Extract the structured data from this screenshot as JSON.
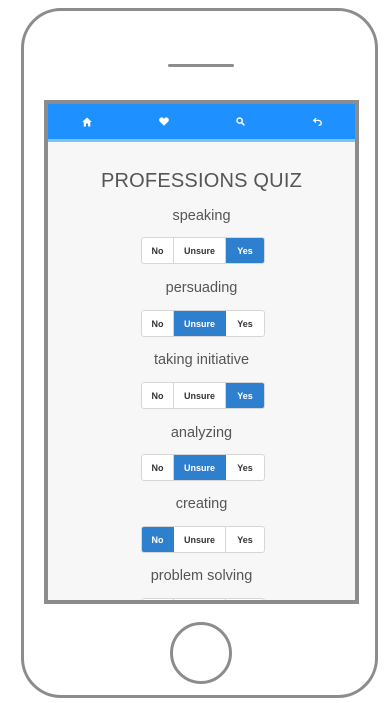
{
  "colors": {
    "navbar": "#1e90ff",
    "navbar_underline": "#7cc4ff",
    "selected": "#2f7fcf",
    "frame": "#8c8c8c"
  },
  "nav": [
    {
      "icon": "home-icon"
    },
    {
      "icon": "heart-icon"
    },
    {
      "icon": "search-icon"
    },
    {
      "icon": "back-icon"
    }
  ],
  "quiz": {
    "title": "PROFESSIONS QUIZ",
    "options": {
      "no": "No",
      "unsure": "Unsure",
      "yes": "Yes"
    },
    "questions": [
      {
        "label": "speaking",
        "selected": "Yes"
      },
      {
        "label": "persuading",
        "selected": "Unsure"
      },
      {
        "label": "taking initiative",
        "selected": "Yes"
      },
      {
        "label": "analyzing",
        "selected": "Unsure"
      },
      {
        "label": "creating",
        "selected": "No"
      },
      {
        "label": "problem solving",
        "selected": ""
      }
    ]
  }
}
